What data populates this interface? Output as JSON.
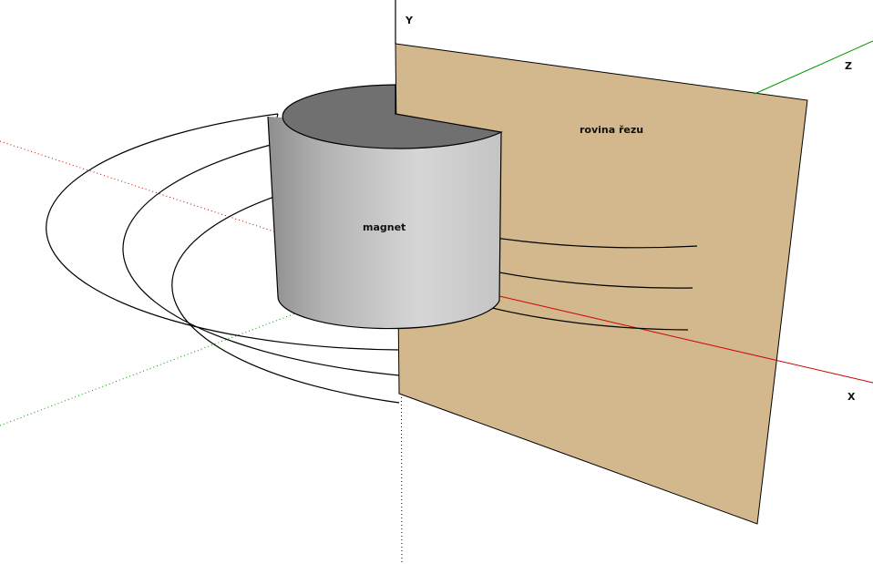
{
  "labels": {
    "magnet": "magnet",
    "plane": "rovina řezu",
    "axis_y": "Y",
    "axis_z": "Z",
    "axis_x": "X"
  },
  "colors": {
    "background": "#ffffff",
    "plane_fill": "#d2b88c",
    "cylinder_top": "#707070",
    "cylinder_side_dark": "#909090",
    "cylinder_side_light": "#d2d2d2",
    "axis_x": "#cc0000",
    "axis_z": "#009900",
    "axis_y": "#000000",
    "field_lines": "#000000"
  }
}
